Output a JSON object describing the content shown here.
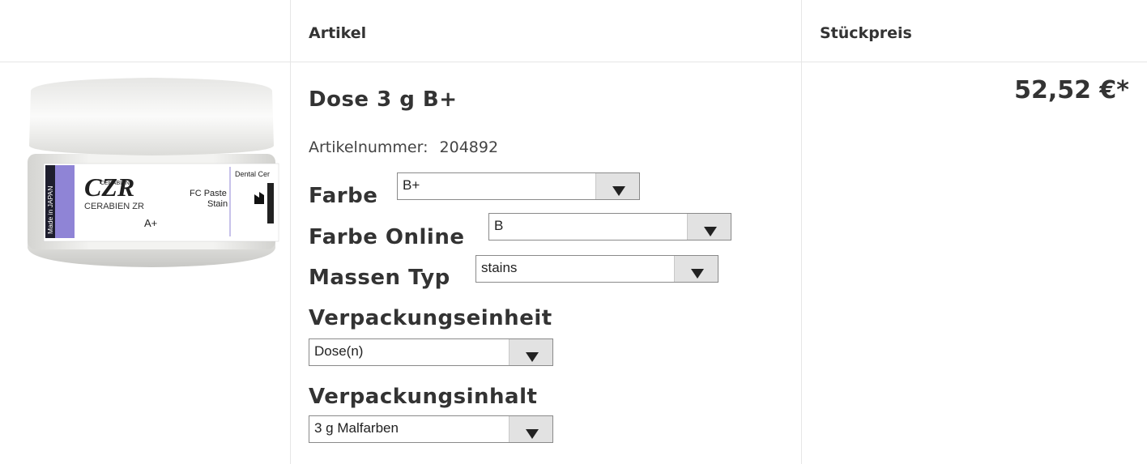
{
  "table": {
    "headers": {
      "image": "",
      "article": "Artikel",
      "price": "Stückpreis"
    }
  },
  "product": {
    "title": "Dose 3 g B+",
    "article_number_label": "Artikelnummer:",
    "article_number": "204892",
    "price": "52,52 €*",
    "image": {
      "brand": "CZR",
      "brand_small": "CERABIEN",
      "product_line": "CERABIEN ZR",
      "shade": "A+",
      "type_line1": "FC Paste",
      "type_line2": "Stain",
      "origin": "Made in JAPAN",
      "maker_partial": "Dental Cer"
    }
  },
  "options": {
    "farbe": {
      "label": "Farbe",
      "value": "B+"
    },
    "farbe_online": {
      "label": "Farbe Online",
      "value": "B"
    },
    "massen_typ": {
      "label": "Massen Typ",
      "value": "stains"
    },
    "verpackungseinheit": {
      "label": "Verpackungseinheit",
      "value": "Dose(n)"
    },
    "verpackungsinhalt": {
      "label": "Verpackungsinhalt",
      "value": "3 g Malfarben"
    }
  },
  "colors": {
    "accent_purple": "#8f84d6",
    "text": "#333333",
    "border": "#e6e6e6"
  }
}
